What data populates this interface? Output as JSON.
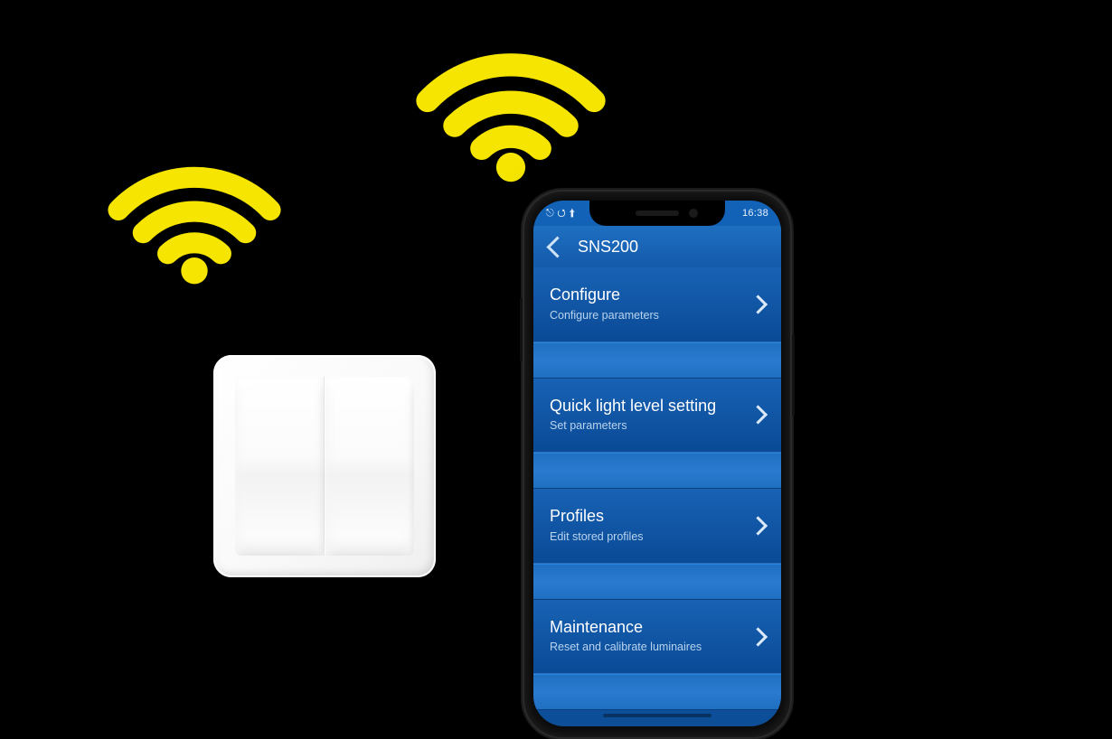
{
  "statusbar": {
    "left_icons": "⎋ ⭯ ⬆",
    "time": "16:38"
  },
  "header": {
    "title": "SNS200"
  },
  "menu": [
    {
      "title": "Configure",
      "subtitle": "Configure parameters"
    },
    {
      "title": "Quick light level setting",
      "subtitle": "Set parameters"
    },
    {
      "title": "Profiles",
      "subtitle": "Edit stored profiles"
    },
    {
      "title": "Maintenance",
      "subtitle": "Reset and calibrate luminaires"
    }
  ],
  "colors": {
    "accent": "#f5e500",
    "app_blue_top": "#1263b8",
    "app_blue_bottom": "#0d4e97"
  }
}
